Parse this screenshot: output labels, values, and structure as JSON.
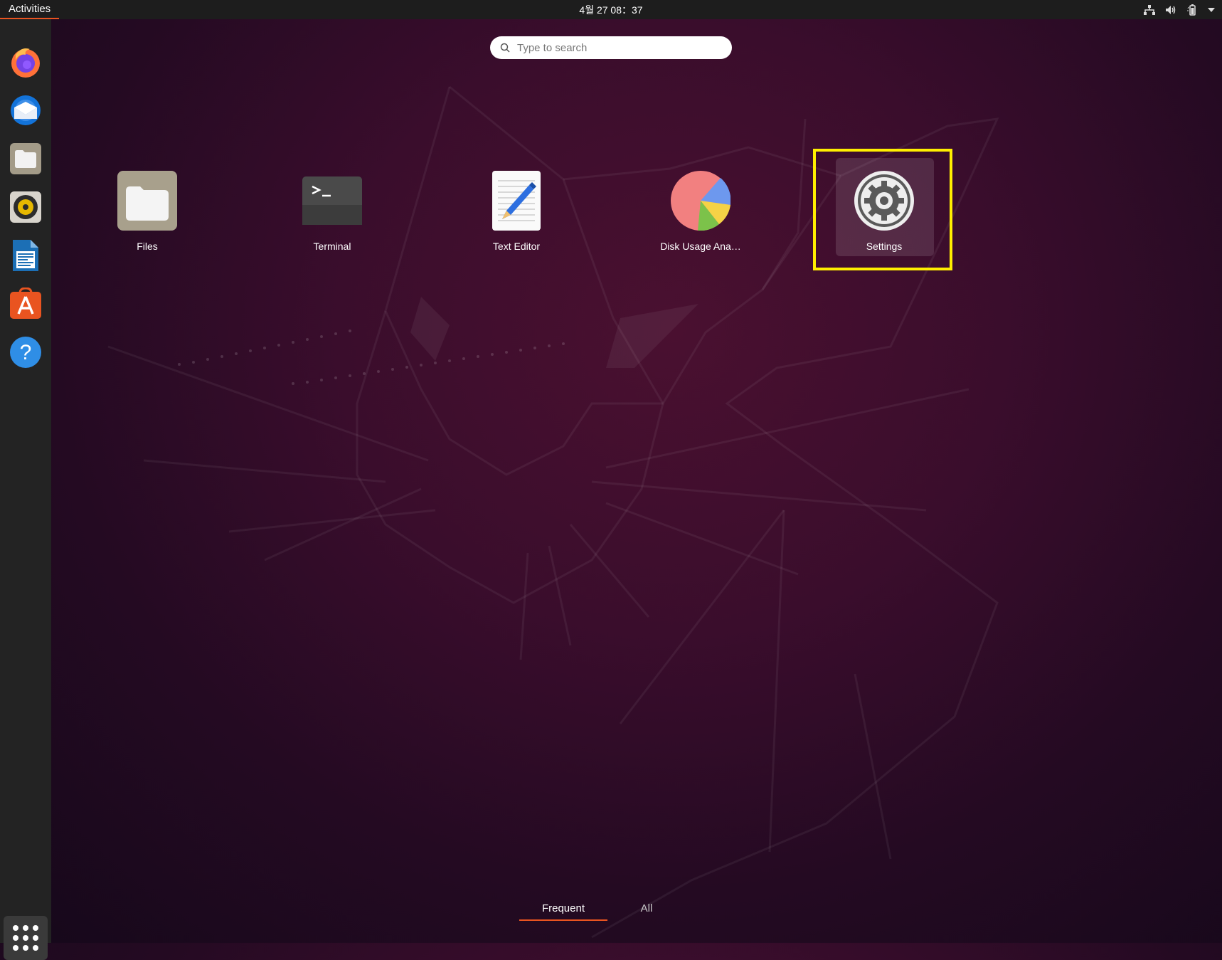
{
  "topbar": {
    "activities": "Activities",
    "clock": "4월 27  08：37"
  },
  "search": {
    "placeholder": "Type to search"
  },
  "dock": {
    "items": [
      {
        "name": "firefox-icon"
      },
      {
        "name": "thunderbird-icon"
      },
      {
        "name": "files-icon"
      },
      {
        "name": "rhythmbox-icon"
      },
      {
        "name": "libreoffice-writer-icon"
      },
      {
        "name": "ubuntu-software-icon"
      },
      {
        "name": "help-icon"
      }
    ],
    "show_apps": "show-applications-icon"
  },
  "apps": [
    {
      "label": "Files"
    },
    {
      "label": "Terminal"
    },
    {
      "label": "Text Editor"
    },
    {
      "label": "Disk Usage Ana…"
    },
    {
      "label": "Settings"
    }
  ],
  "tabs": {
    "frequent": "Frequent",
    "all": "All"
  },
  "colors": {
    "accent": "#e95420",
    "highlight": "#ffee00",
    "topbar": "#1d1d1d",
    "dock": "#232323"
  }
}
